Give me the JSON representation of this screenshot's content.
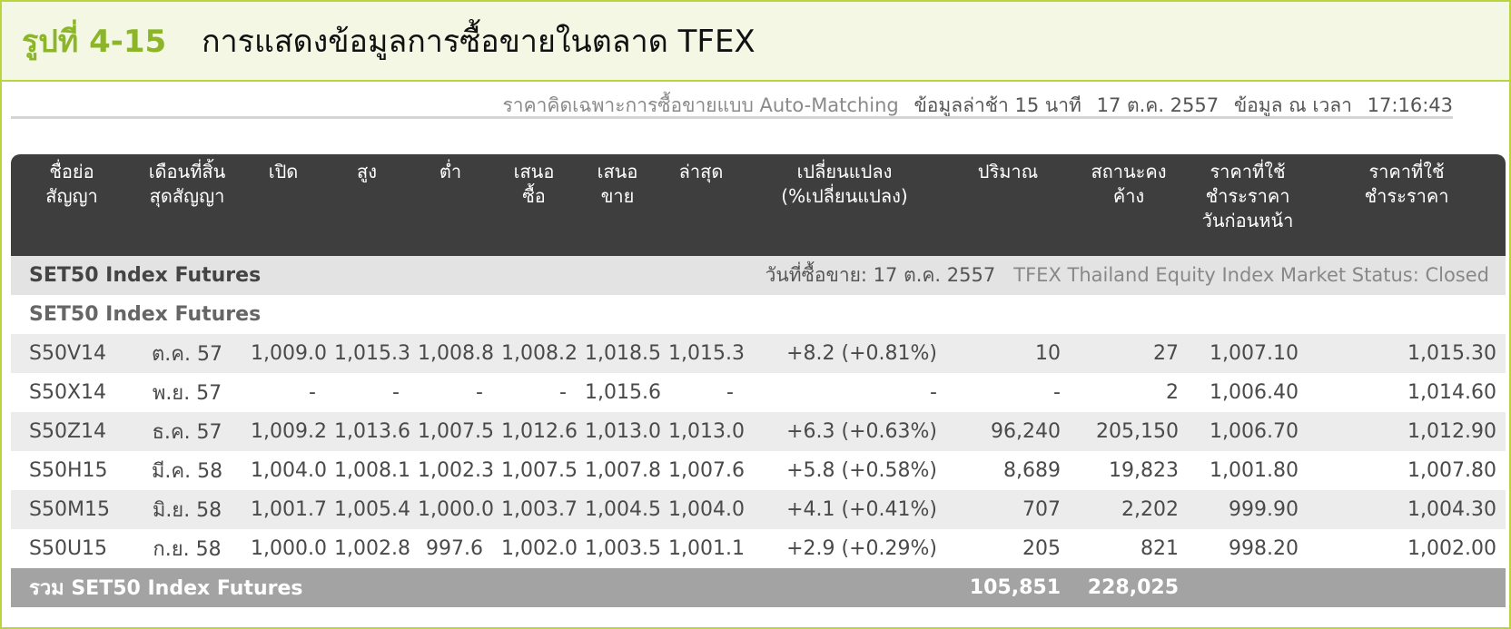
{
  "figure": {
    "number": "รูปที่ 4-15",
    "caption": "การแสดงข้อมูลการซื้อขายในตลาด TFEX"
  },
  "info": {
    "note": "ราคาคิดเฉพาะการซื้อขายแบบ Auto-Matching",
    "delay": "ข้อมูลล่าช้า 15 นาที",
    "date": "17 ต.ค. 2557",
    "time_label": "ข้อมูล ณ เวลา",
    "time": "17:16:43"
  },
  "table": {
    "headers": [
      "ชื่อย่อ\nสัญญา",
      "เดือนที่สิ้น\nสุดสัญญา",
      "เปิด",
      "สูง",
      "ต่ำ",
      "เสนอ\nซื้อ",
      "เสนอ\nขาย",
      "ล่าสุด",
      "เปลี่ยนแปลง\n(%เปลี่ยนแปลง)",
      "ปริมาณ",
      "สถานะคง\nค้าง",
      "ราคาที่ใช้\nชำระราคา\nวันก่อนหน้า",
      "ราคาที่ใช้\nชำระราคา"
    ],
    "group": {
      "name": "SET50 Index Futures",
      "trade_date": "วันที่ซื้อขาย: 17 ต.ค. 2557",
      "market_status": "TFEX Thailand Equity Index Market Status: Closed"
    },
    "subgroup": "SET50 Index Futures",
    "rows": [
      [
        "S50V14",
        "ต.ค. 57",
        "1,009.0",
        "1,015.3",
        "1,008.8",
        "1,008.2",
        "1,018.5",
        "1,015.3",
        "+8.2 (+0.81%)",
        "10",
        "27",
        "1,007.10",
        "1,015.30"
      ],
      [
        "S50X14",
        "พ.ย. 57",
        "-",
        "-",
        "-",
        "-",
        "1,015.6",
        "-",
        "-",
        "-",
        "2",
        "1,006.40",
        "1,014.60"
      ],
      [
        "S50Z14",
        "ธ.ค. 57",
        "1,009.2",
        "1,013.6",
        "1,007.5",
        "1,012.6",
        "1,013.0",
        "1,013.0",
        "+6.3 (+0.63%)",
        "96,240",
        "205,150",
        "1,006.70",
        "1,012.90"
      ],
      [
        "S50H15",
        "มี.ค. 58",
        "1,004.0",
        "1,008.1",
        "1,002.3",
        "1,007.5",
        "1,007.8",
        "1,007.6",
        "+5.8 (+0.58%)",
        "8,689",
        "19,823",
        "1,001.80",
        "1,007.80"
      ],
      [
        "S50M15",
        "มิ.ย. 58",
        "1,001.7",
        "1,005.4",
        "1,000.0",
        "1,003.7",
        "1,004.5",
        "1,004.0",
        "+4.1 (+0.41%)",
        "707",
        "2,202",
        "999.90",
        "1,004.30"
      ],
      [
        "S50U15",
        "ก.ย. 58",
        "1,000.0",
        "1,002.8",
        "997.6",
        "1,002.0",
        "1,003.5",
        "1,001.1",
        "+2.9 (+0.29%)",
        "205",
        "821",
        "998.20",
        "1,002.00"
      ]
    ],
    "total": {
      "label": "รวม SET50 Index Futures",
      "volume": "105,851",
      "open_interest": "228,025"
    }
  }
}
